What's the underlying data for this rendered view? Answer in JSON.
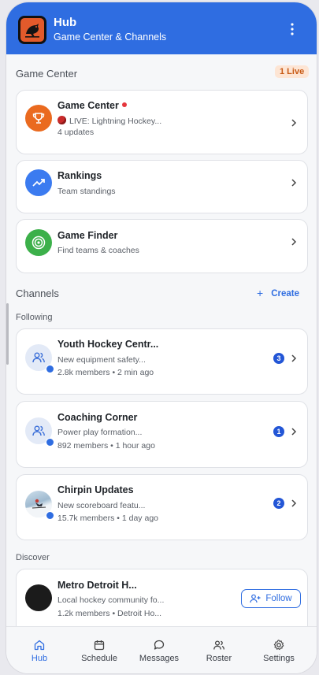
{
  "header": {
    "title": "Hub",
    "subtitle": "Game Center & Channels"
  },
  "game_center": {
    "section_title": "Game Center",
    "live_badge": "1 Live",
    "cards": [
      {
        "title": "Game Center",
        "line1": "LIVE: Lightning Hockey...",
        "line2": "4 updates",
        "icon": "trophy-icon",
        "color": "#ea6a1f"
      },
      {
        "title": "Rankings",
        "line1": "Team standings",
        "icon": "trending-up-icon",
        "color": "#3b7bf0"
      },
      {
        "title": "Game Finder",
        "line1": "Find teams & coaches",
        "icon": "target-icon",
        "color": "#3cb04a"
      }
    ]
  },
  "channels": {
    "section_title": "Channels",
    "create_label": "Create",
    "following_label": "Following",
    "items": [
      {
        "title": "Youth Hockey Centr...",
        "preview": "New equipment safety...",
        "meta": "2.8k members • 2 min ago",
        "unread": "3"
      },
      {
        "title": "Coaching Corner",
        "preview": "Power play formation...",
        "meta": "892 members • 1 hour ago",
        "unread": "1"
      },
      {
        "title": "Chirpin Updates",
        "preview": "New scoreboard featu...",
        "meta": "15.7k members • 1 day ago",
        "unread": "2"
      }
    ],
    "discover_label": "Discover",
    "discover": [
      {
        "title": "Metro Detroit H...",
        "preview": "Local hockey community fo...",
        "meta": "1.2k members • Detroit Ho...",
        "button": "Follow"
      }
    ]
  },
  "nav": {
    "items": [
      {
        "label": "Hub",
        "icon": "home-icon",
        "active": true
      },
      {
        "label": "Schedule",
        "icon": "calendar-icon"
      },
      {
        "label": "Messages",
        "icon": "message-icon"
      },
      {
        "label": "Roster",
        "icon": "people-icon"
      },
      {
        "label": "Settings",
        "icon": "gear-icon"
      }
    ]
  },
  "colors": {
    "accent": "#2f6de1",
    "live_badge_bg": "#fde5d4",
    "live_badge_text": "#c85a15",
    "unread_badge": "#2356d6"
  }
}
